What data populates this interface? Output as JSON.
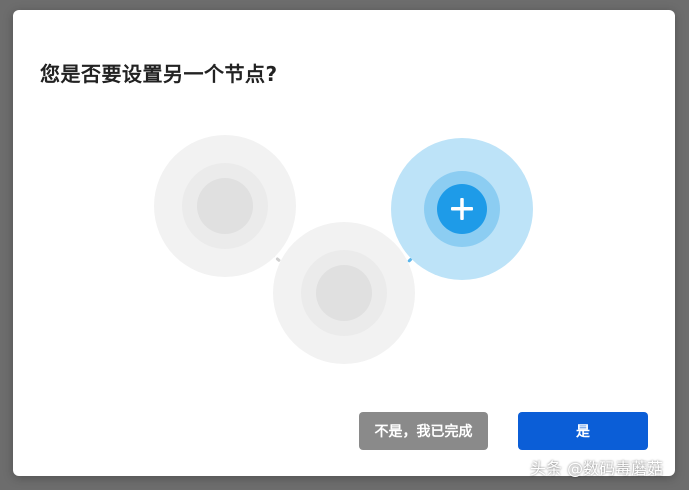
{
  "dialog": {
    "title": "您是否要设置另一个节点?",
    "no_button_label": "不是，我已完成",
    "yes_button_label": "是"
  },
  "watermark": "头条 @数码毒蘑菇",
  "colors": {
    "accent": "#0b5ed7",
    "node_active": "#1e9be8",
    "node_inactive": "#e0e0e0",
    "secondary_button": "#8a8a8a"
  },
  "illustration": {
    "nodes": [
      {
        "name": "existing-node-1",
        "state": "inactive"
      },
      {
        "name": "existing-node-2",
        "state": "inactive"
      },
      {
        "name": "new-node",
        "state": "active",
        "icon": "plus-icon"
      }
    ]
  }
}
